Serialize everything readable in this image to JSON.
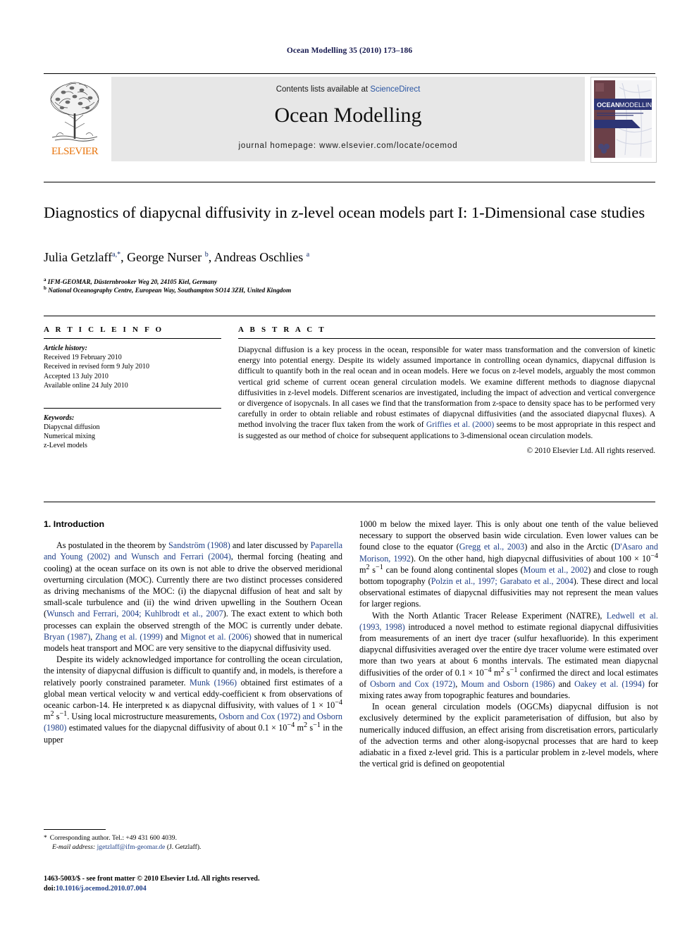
{
  "running_head": "Ocean Modelling 35 (2010) 173–186",
  "banner": {
    "contents_prefix": "Contents lists available at ",
    "sciencedirect": "ScienceDirect",
    "journal_title": "Ocean Modelling",
    "homepage": "journal homepage: www.elsevier.com/locate/ocemod",
    "publisher": "ELSEVIER",
    "cover_title_1": "OCEAN",
    "cover_title_2": "MODELLING",
    "cover_subtitle": "An International Journal"
  },
  "article": {
    "title": "Diagnostics of diapycnal diffusivity in z-level ocean models part I: 1-Dimensional case studies",
    "authors_html": "Julia Getzlaff<sup>a,*</sup>, George Nurser <sup>b</sup>, Andreas Oschlies <sup>a</sup>",
    "affiliation_a": "IFM-GEOMAR, Düsternbrooker Weg 20, 24105 Kiel, Germany",
    "affiliation_b": "National Oceanography Centre, European Way, Southampton SO14 3ZH, United Kingdom"
  },
  "info": {
    "heading": "A R T I C L E    I N F O",
    "history_label": "Article history:",
    "history": [
      "Received 19 February 2010",
      "Received in revised form 9 July 2010",
      "Accepted 13 July 2010",
      "Available online 24 July 2010"
    ],
    "keywords_label": "Keywords:",
    "keywords": [
      "Diapycnal diffusion",
      "Numerical mixing",
      "z-Level models"
    ]
  },
  "abstract": {
    "heading": "A B S T R A C T",
    "text_html": "Diapycnal diffusion is a key process in the ocean, responsible for water mass transformation and the conversion of kinetic energy into potential energy. Despite its widely assumed importance in controlling ocean dynamics, diapycnal diffusion is difficult to quantify both in the real ocean and in ocean models. Here we focus on z-level models, arguably the most common vertical grid scheme of current ocean general circulation models. We examine different methods to diagnose diapycnal diffusivities in z-level models. Different scenarios are investigated, including the impact of advection and vertical convergence or divergence of isopycnals. In all cases we find that the transformation from z-space to density space has to be performed very carefully in order to obtain reliable and robust estimates of diapycnal diffusivities (and the associated diapycnal fluxes). A method involving the tracer flux taken from the work of <span class=\"ref\">Griffies et al. (2000)</span> seems to be most appropriate in this respect and is suggested as our method of choice for subsequent applications to 3-dimensional ocean circulation models.",
    "copyright": "© 2010 Elsevier Ltd. All rights reserved."
  },
  "body": {
    "section_title": "1. Introduction",
    "left_paragraphs_html": [
      "As postulated in the theorem by <span class=\"ref\">Sandström (1908)</span> and later discussed by <span class=\"ref\">Paparella and Young (2002) and Wunsch and Ferrari (2004)</span>, thermal forcing (heating and cooling) at the ocean surface on its own is not able to drive the observed meridional overturning circulation (MOC). Currently there are two distinct processes considered as driving mechanisms of the MOC: (i) the diapycnal diffusion of heat and salt by small-scale turbulence and (ii) the wind driven upwelling in the Southern Ocean (<span class=\"ref\">Wunsch and Ferrari, 2004; Kuhlbrodt et al., 2007</span>). The exact extent to which both processes can explain the observed strength of the MOC is currently under debate. <span class=\"ref\">Bryan (1987)</span>, <span class=\"ref\">Zhang et al. (1999)</span> and <span class=\"ref\">Mignot et al. (2006)</span> showed that in numerical models heat transport and MOC are very sensitive to the diapycnal diffusivity used.",
      "Despite its widely acknowledged importance for controlling the ocean circulation, the intensity of diapycnal diffusion is difficult to quantify and, in models, is therefore a relatively poorly constrained parameter. <span class=\"ref\">Munk (1966)</span> obtained first estimates of a global mean vertical velocity w and vertical eddy-coefficient κ from observations of oceanic carbon-14. He interpreted κ as diapycnal diffusivity, with values of 1 × 10<sup>−4</sup> m<sup>2</sup> s<sup>−1</sup>. Using local microstructure measurements, <span class=\"ref\">Osborn and Cox (1972) and Osborn (1980)</span> estimated values for the diapycnal diffusivity of about 0.1 × 10<sup>−4</sup> m<sup>2</sup> s<sup>−1</sup> in the upper"
    ],
    "right_paragraphs_html": [
      "1000 m below the mixed layer. This is only about one tenth of the value believed necessary to support the observed basin wide circulation. Even lower values can be found close to the equator (<span class=\"ref\">Gregg et al., 2003</span>) and also in the Arctic (<span class=\"ref\">D'Asaro and Morison, 1992</span>). On the other hand, high diapycnal diffusivities of about 100 × 10<sup>−4</sup> m<sup>2</sup> s<sup>−1</sup> can be found along continental slopes (<span class=\"ref\">Moum et al., 2002</span>) and close to rough bottom topography (<span class=\"ref\">Polzin et al., 1997; Garabato et al., 2004</span>). These direct and local observational estimates of diapycnal diffusivities may not represent the mean values for larger regions.",
      "With the North Atlantic Tracer Release Experiment (NATRE), <span class=\"ref\">Ledwell et al. (1993, 1998)</span> introduced a novel method to estimate regional diapycnal diffusivities from measurements of an inert dye tracer (sulfur hexafluoride). In this experiment diapycnal diffusivities averaged over the entire dye tracer volume were estimated over more than two years at about 6 months intervals. The estimated mean diapycnal diffusivities of the order of 0.1 × 10<sup>−4</sup> m<sup>2</sup> s<sup>−1</sup> confirmed the direct and local estimates of <span class=\"ref\">Osborn and Cox (1972)</span>, <span class=\"ref\">Moum and Osborn (1986)</span> and <span class=\"ref\">Oakey et al. (1994)</span> for mixing rates away from topographic features and boundaries.",
      "In ocean general circulation models (OGCMs) diapycnal diffusion is not exclusively determined by the explicit parameterisation of diffusion, but also by numerically induced diffusion, an effect arising from discretisation errors, particularly of the advection terms and other along-isopycnal processes that are hard to keep adiabatic in a fixed z-level grid. This is a particular problem in z-level models, where the vertical grid is defined on geopotential"
    ]
  },
  "footnote": {
    "star": "*",
    "corresponding_html": "Corresponding author. Tel.: +49 431 600 4039.",
    "email_label": "E-mail address:",
    "email": "jgetzlaff@ifm-geomar.de",
    "email_owner": "(J. Getzlaff)."
  },
  "page_footer": {
    "issn_line": "1463-5003/$ - see front matter © 2010 Elsevier Ltd. All rights reserved.",
    "doi_label": "doi:",
    "doi": "10.1016/j.ocemod.2010.07.004"
  },
  "colors": {
    "running_head": "#16194f",
    "reference_link": "#1f3f87",
    "sciencedirect": "#2a55a3",
    "elsevier_orange": "#e8740c",
    "banner_bg": "#e7e7e7",
    "cover_maroon": "#6b4048",
    "cover_navy": "#2d3575"
  }
}
